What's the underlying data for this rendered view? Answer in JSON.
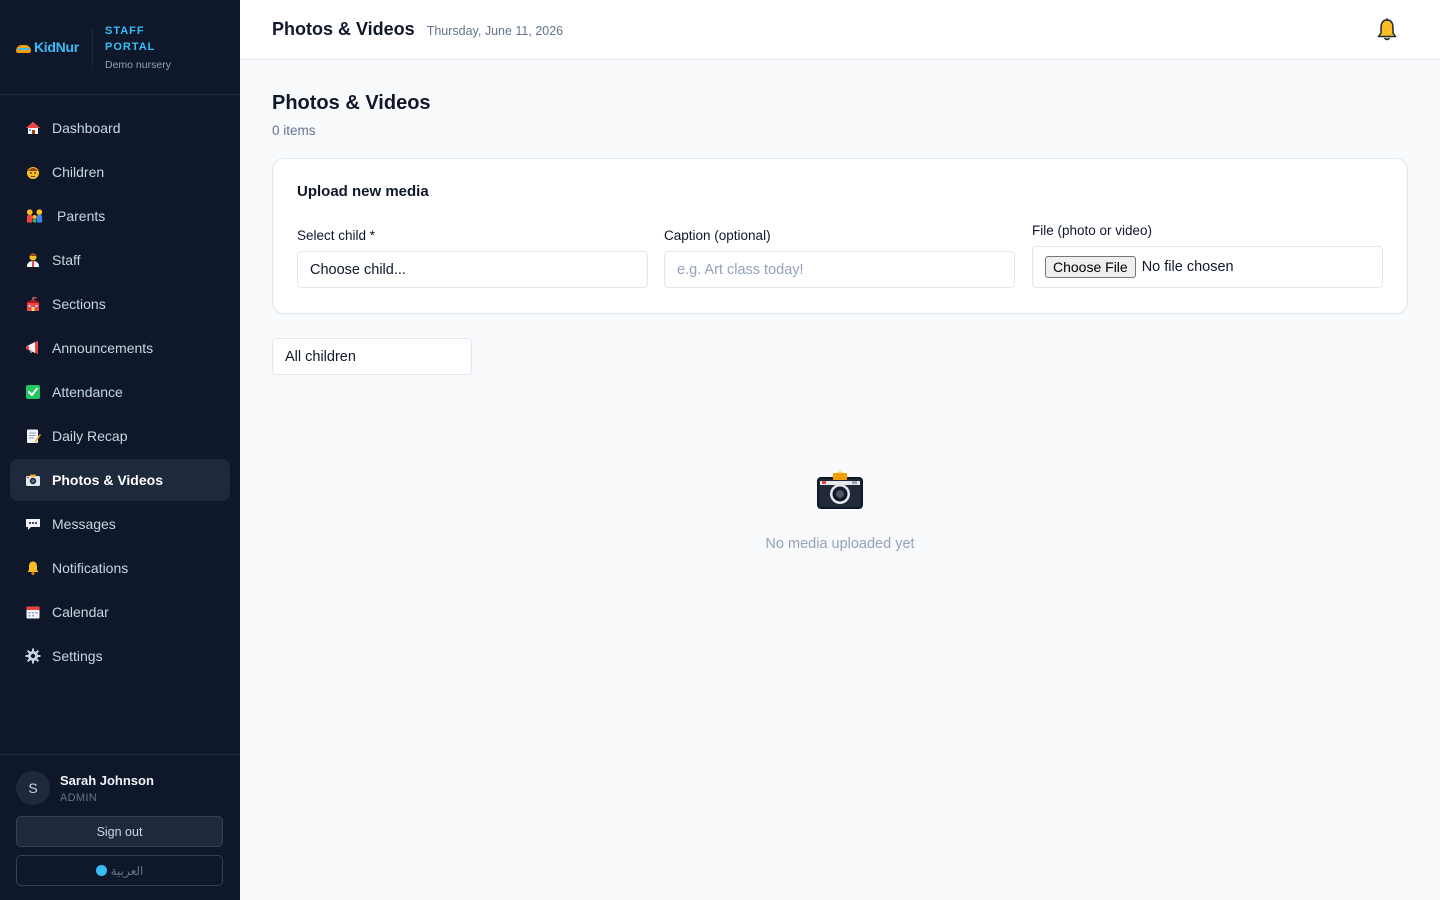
{
  "brand": {
    "logo_text": "KidNur",
    "portal_line1": "STAFF",
    "portal_line2": "PORTAL",
    "nursery": "Demo nursery"
  },
  "sidebar": {
    "items": [
      {
        "label": "Dashboard",
        "icon": "house-icon"
      },
      {
        "label": "Children",
        "icon": "child-face-icon"
      },
      {
        "label": "Parents",
        "icon": "family-icon"
      },
      {
        "label": "Staff",
        "icon": "teacher-icon"
      },
      {
        "label": "Sections",
        "icon": "school-icon"
      },
      {
        "label": "Announcements",
        "icon": "megaphone-icon"
      },
      {
        "label": "Attendance",
        "icon": "check-box-icon"
      },
      {
        "label": "Daily Recap",
        "icon": "memo-icon"
      },
      {
        "label": "Photos & Videos",
        "icon": "camera-icon",
        "active": true
      },
      {
        "label": "Messages",
        "icon": "speech-bubble-icon"
      },
      {
        "label": "Notifications",
        "icon": "bell-icon"
      },
      {
        "label": "Calendar",
        "icon": "calendar-icon"
      },
      {
        "label": "Settings",
        "icon": "gear-icon"
      }
    ]
  },
  "user": {
    "initial": "S",
    "name": "Sarah Johnson",
    "role": "ADMIN",
    "signout_label": "Sign out",
    "language_label": "العربية"
  },
  "header": {
    "title": "Photos & Videos",
    "date": "Thursday, June 11, 2026"
  },
  "main": {
    "title": "Photos & Videos",
    "count": "0 items",
    "upload": {
      "title": "Upload new media",
      "child_label": "Select child *",
      "child_value": "Choose child...",
      "caption_label": "Caption (optional)",
      "caption_placeholder": "e.g. Art class today!",
      "file_label": "File (photo or video)",
      "file_button": "Choose File",
      "file_status": "No file chosen"
    },
    "filter_value": "All children",
    "empty_text": "No media uploaded yet"
  },
  "colors": {
    "sidebar_bg": "#0f172a",
    "accent": "#38bdf8",
    "bell": "#f59e0b"
  }
}
